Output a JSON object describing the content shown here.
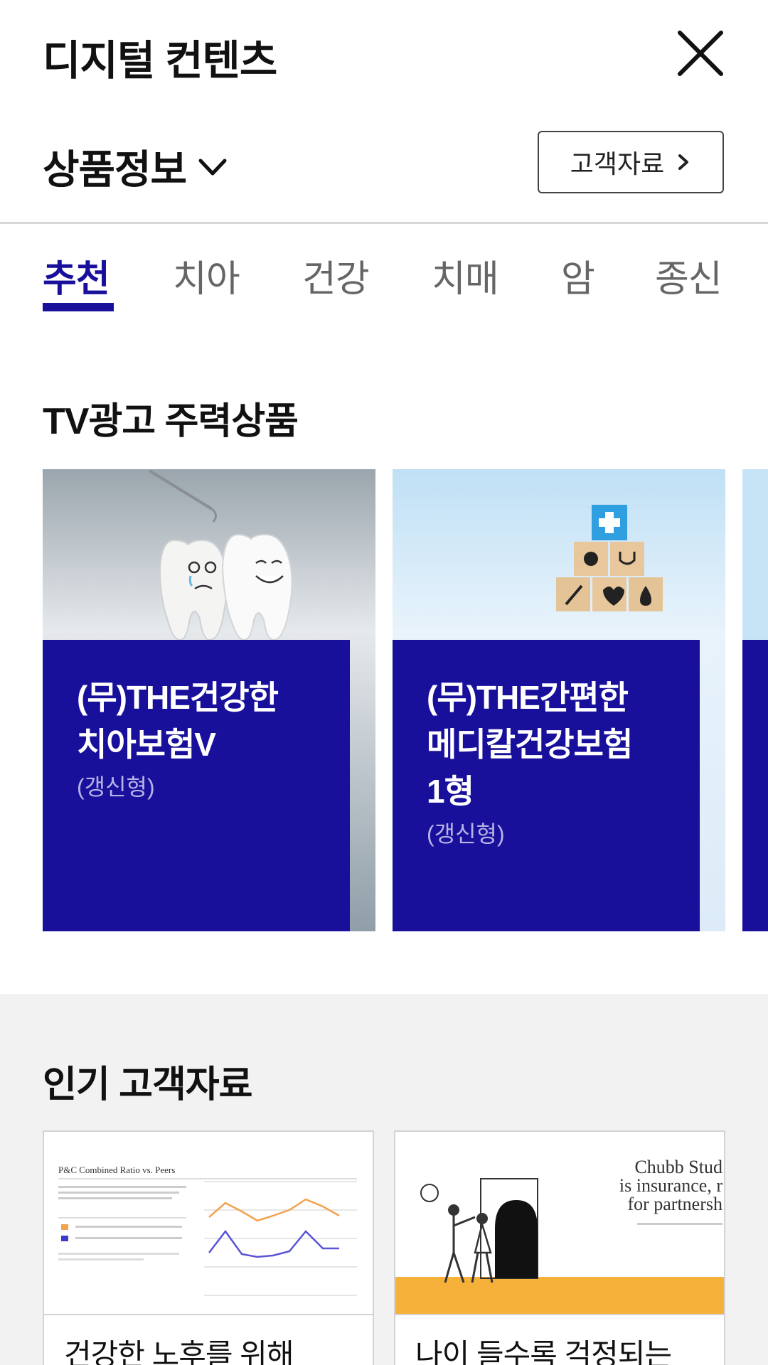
{
  "header": {
    "title": "디지털 컨텐츠",
    "close_icon": "close-icon"
  },
  "section": {
    "selected": "상품정보",
    "dropdown_icon": "chevron-down-icon",
    "customer_button_label": "고객자료",
    "customer_button_icon": "chevron-right-icon"
  },
  "tabs": [
    {
      "label": "추천",
      "active": true
    },
    {
      "label": "치아",
      "active": false
    },
    {
      "label": "건강",
      "active": false
    },
    {
      "label": "치매",
      "active": false
    },
    {
      "label": "암",
      "active": false
    },
    {
      "label": "종신",
      "active": false
    }
  ],
  "tv_section": {
    "title": "TV광고 주력상품",
    "cards": [
      {
        "title": "(무)THE건강한\n치아보험V",
        "subtitle": "(갱신형)",
        "image": "tooth-characters-illustration"
      },
      {
        "title": "(무)THE간편한\n메디칼건강보험\n1형",
        "subtitle": "(갱신형)",
        "image": "medical-blocks-illustration"
      }
    ]
  },
  "popular_section": {
    "title": "인기 고객자료",
    "docs": [
      {
        "title": "건강한 노후를 위해",
        "thumb_heading": "P&C Combined Ratio vs. Peers"
      },
      {
        "title": "나이 들수록 걱정되는",
        "thumb_heading_line1": "Chubb Stud",
        "thumb_heading_line2": "is insurance, r",
        "thumb_heading_line3": "for partnersh"
      }
    ]
  },
  "colors": {
    "accent": "#18109a",
    "tab_inactive": "#666666",
    "popular_bg": "#f2f2f2",
    "chubb_yellow": "#f6b13a"
  }
}
